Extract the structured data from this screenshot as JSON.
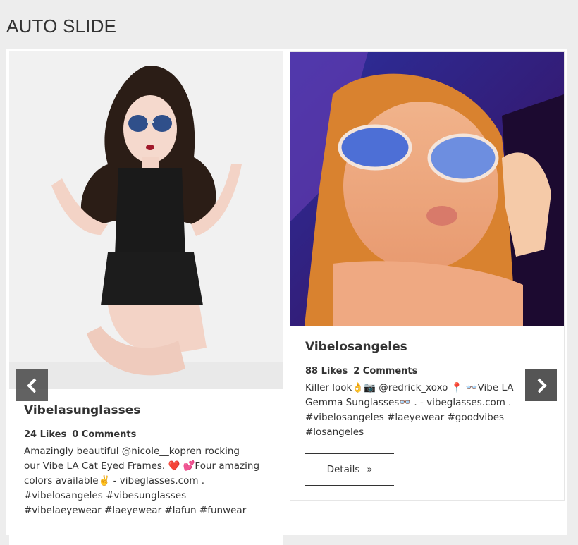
{
  "section": {
    "title": "AUTO SLIDE"
  },
  "slides": [
    {
      "username": "Vibelasunglasses",
      "likes": "24 Likes",
      "comments": "0 Comments",
      "caption_lines": [
        "Amazingly beautiful @nicole__kopren  rocking",
        "our Vibe LA Cat Eyed Frames. ❤️ 💕Four amazing",
        "colors available✌️ - vibeglasses.com .",
        "#vibelosangeles #vibesunglasses",
        "#vibelaeyewear #laeyewear #lafun #funwear"
      ]
    },
    {
      "username": "Vibelosangeles",
      "likes": "88 Likes",
      "comments": "2 Comments",
      "caption_lines": [
        "Killer look👌📷 @redrick_xoxo 📍 👓Vibe LA",
        "Gemma Sunglasses👓 . - vibeglasses.com .",
        "#vibelosangeles #laeyewear #goodvibes",
        "#losangeles"
      ],
      "details_label": "Details"
    }
  ],
  "nav": {
    "prev_icon": "chevron-left-icon",
    "next_icon": "chevron-right-icon"
  },
  "colors": {
    "nav_bg": "#555555",
    "page_bg": "#ededed",
    "card_bg": "#ffffff"
  }
}
